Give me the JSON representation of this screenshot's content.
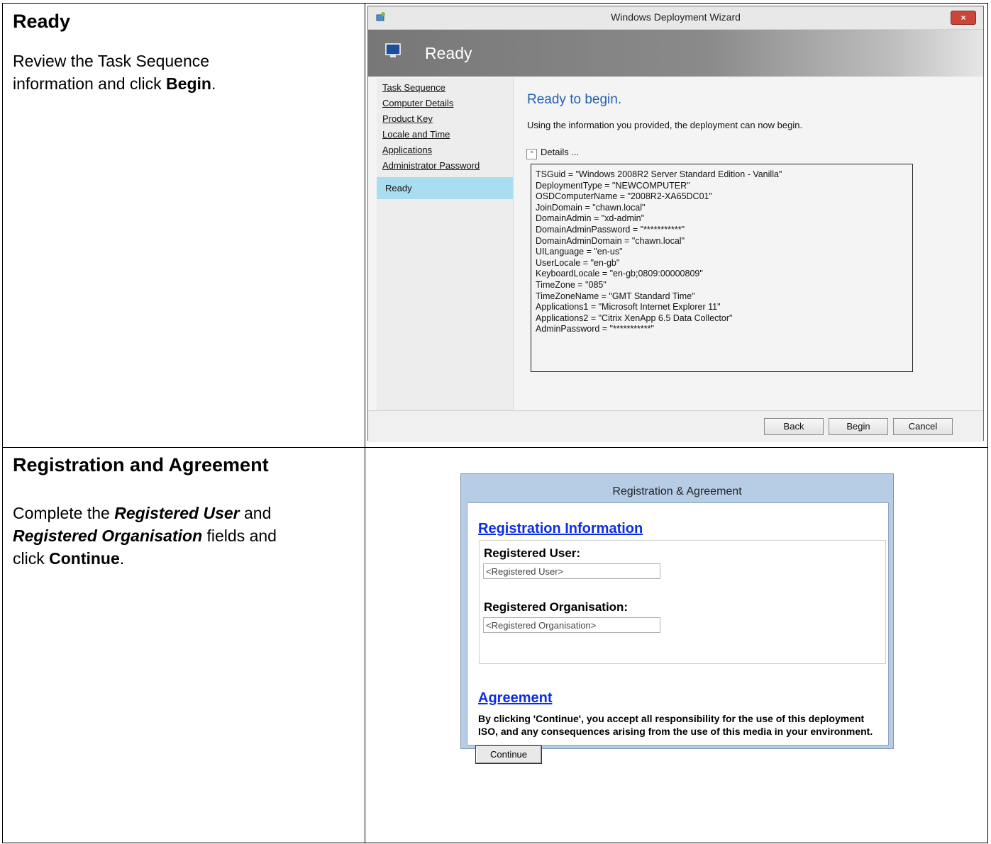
{
  "steps": [
    {
      "heading": "Ready",
      "body": {
        "line1": "Review the Task Sequence",
        "line2_before": "information and click ",
        "line2_bold": "Begin",
        "line2_after": "."
      }
    },
    {
      "heading": "Registration and Agreement",
      "body": {
        "p1": "Complete the ",
        "em1": "Registered User",
        "p2": " and",
        "em2": "Registered Organisation",
        "p3": " fields and",
        "p4": "click ",
        "b1": "Continue",
        "p5": "."
      }
    }
  ],
  "wizard": {
    "window_title": "Windows Deployment Wizard",
    "close_glyph": "×",
    "banner_title": "Ready",
    "nav_items": [
      "Task Sequence",
      "Computer Details",
      "Product Key",
      "Locale and Time",
      "Applications",
      "Administrator Password"
    ],
    "nav_current": "Ready",
    "heading": "Ready to begin.",
    "subtext": "Using the information you provided, the deployment can now begin.",
    "details_toggle": "Details ...",
    "details_glyph": "⌃",
    "details": [
      "TSGuid = \"Windows 2008R2 Server Standard Edition - Vanilla\"",
      "DeploymentType = \"NEWCOMPUTER\"",
      "OSDComputerName = \"2008R2-XA65DC01\"",
      "JoinDomain = \"chawn.local\"",
      "DomainAdmin = \"xd-admin\"",
      "DomainAdminPassword = \"***********\"",
      "DomainAdminDomain = \"chawn.local\"",
      "UILanguage = \"en-us\"",
      "UserLocale = \"en-gb\"",
      "KeyboardLocale = \"en-gb;0809:00000809\"",
      "TimeZone = \"085\"",
      "TimeZoneName = \"GMT Standard Time\"",
      "Applications1 = \"Microsoft Internet Explorer 11\"",
      "Applications2 = \"Citrix XenApp 6.5 Data Collector\"",
      "AdminPassword = \"***********\""
    ],
    "buttons": {
      "back": "Back",
      "begin": "Begin",
      "cancel": "Cancel"
    },
    "colors": {
      "heading": "#2160b0",
      "nav_selected": "#a8def0",
      "close": "#c8463a"
    }
  },
  "registration": {
    "window_title": "Registration & Agreement",
    "section_info": "Registration Information",
    "user_label": "Registered User:",
    "user_value": "<Registered User>",
    "org_label": "Registered Organisation:",
    "org_value": "<Registered Organisation>",
    "section_agreement": "Agreement",
    "agreement_text": "By clicking 'Continue', you accept all responsibility for the use of this deployment ISO, and any consequences arising from the use of this media in your environment.",
    "continue": "Continue",
    "colors": {
      "link": "#0c2de6",
      "frame": "#b7cde6"
    }
  }
}
